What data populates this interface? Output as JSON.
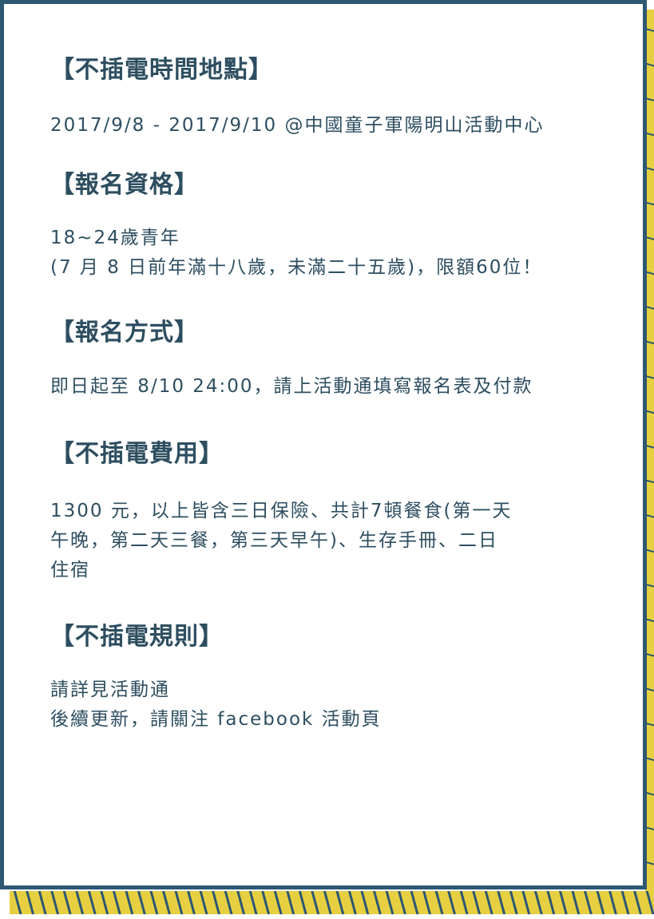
{
  "sections": [
    {
      "heading": "【不插電時間地點】",
      "body": "2017/9/8 - 2017/9/10 @中國童子軍陽明山活動中心"
    },
    {
      "heading": "【報名資格】",
      "body": "18~24歲青年\n(7 月 8 日前年滿十八歲，未滿二十五歲)，限額60位！"
    },
    {
      "heading": "【報名方式】",
      "body": "即日起至 8/10 24:00，請上活動通填寫報名表及付款"
    },
    {
      "heading": "【不插電費用】",
      "body": "1300 元，以上皆含三日保險、共計7頓餐食(第一天\n午晚，第二天三餐，第三天早午)、生存手冊、二日\n住宿"
    },
    {
      "heading": "【不插電規則】",
      "body": "請詳見活動通\n後續更新，請關注 facebook 活動頁"
    }
  ],
  "colors": {
    "border": "#2d5872",
    "accent_stripe": "#e6cf41",
    "text": "#2e4e60"
  }
}
